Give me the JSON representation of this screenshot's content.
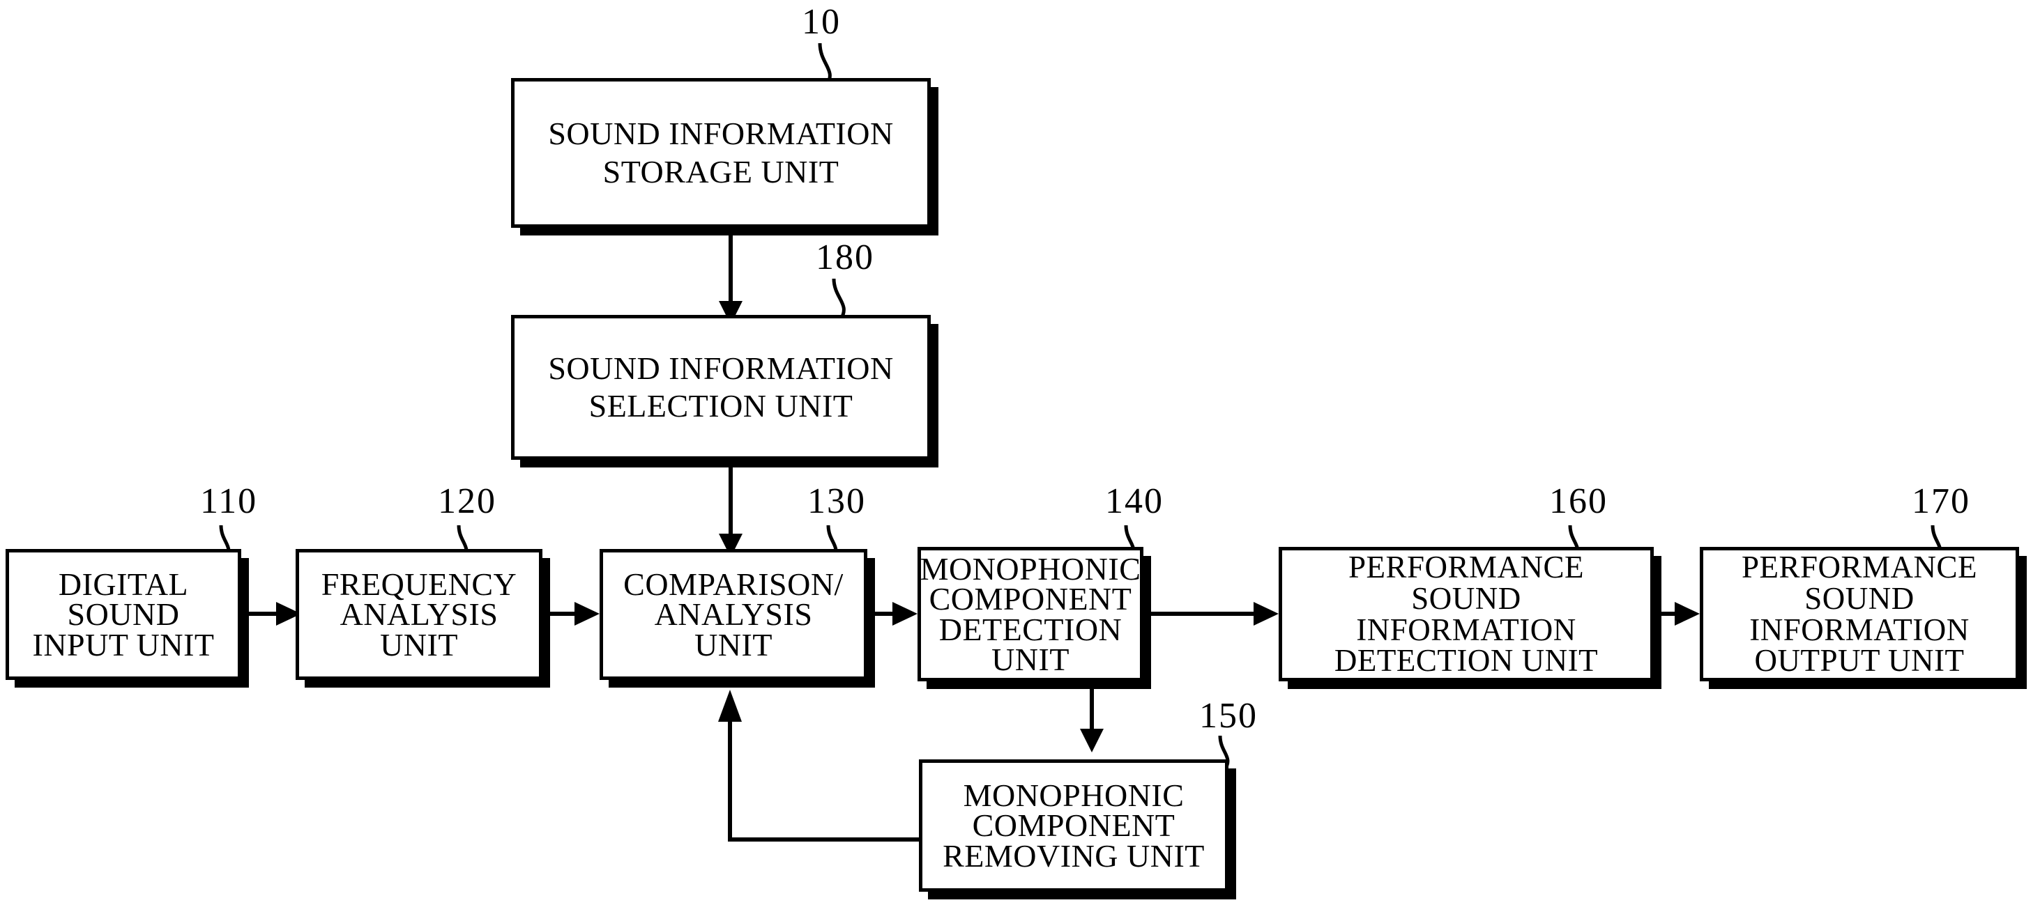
{
  "figure": {
    "type": "patent-block-diagram",
    "title": "",
    "background": "#ffffff",
    "ink": "#000000"
  },
  "blocks": [
    {
      "id": "b10",
      "ref": "10",
      "label": "SOUND INFORMATION\nSTORAGE UNIT"
    },
    {
      "id": "b180",
      "ref": "180",
      "label": "SOUND INFORMATION\nSELECTION UNIT"
    },
    {
      "id": "b110",
      "ref": "110",
      "label": "DIGITAL\nSOUND\nINPUT UNIT"
    },
    {
      "id": "b120",
      "ref": "120",
      "label": "FREQUENCY\nANALYSIS\nUNIT"
    },
    {
      "id": "b130",
      "ref": "130",
      "label": "COMPARISON/\nANALYSIS\nUNIT"
    },
    {
      "id": "b140",
      "ref": "140",
      "label": "MONOPHONIC\nCOMPONENT\nDETECTION UNIT"
    },
    {
      "id": "b160",
      "ref": "160",
      "label": "PERFORMANCE\nSOUND\nINFORMATION\nDETECTION UNIT"
    },
    {
      "id": "b170",
      "ref": "170",
      "label": "PERFORMANCE\nSOUND\nINFORMATION\nOUTPUT UNIT"
    },
    {
      "id": "b150",
      "ref": "150",
      "label": "MONOPHONIC\nCOMPONENT\nREMOVING UNIT"
    }
  ],
  "refnums": {
    "r10": "10",
    "r180": "180",
    "r110": "110",
    "r120": "120",
    "r130": "130",
    "r140": "140",
    "r150": "150",
    "r160": "160",
    "r170": "170"
  },
  "connections": [
    {
      "from": "b10",
      "to": "b180",
      "direction": "down",
      "arrow": true
    },
    {
      "from": "b180",
      "to": "b130",
      "direction": "down",
      "arrow": true
    },
    {
      "from": "b110",
      "to": "b120",
      "direction": "right",
      "arrow": true
    },
    {
      "from": "b120",
      "to": "b130",
      "direction": "right",
      "arrow": true
    },
    {
      "from": "b130",
      "to": "b140",
      "direction": "right",
      "arrow": true
    },
    {
      "from": "b140",
      "to": "b160",
      "direction": "right",
      "arrow": true
    },
    {
      "from": "b160",
      "to": "b170",
      "direction": "right",
      "arrow": true
    },
    {
      "from": "b140",
      "to": "b150",
      "direction": "down",
      "arrow": true
    },
    {
      "from": "b150",
      "to": "b130",
      "direction": "feedback-left-up",
      "arrow": true
    }
  ]
}
